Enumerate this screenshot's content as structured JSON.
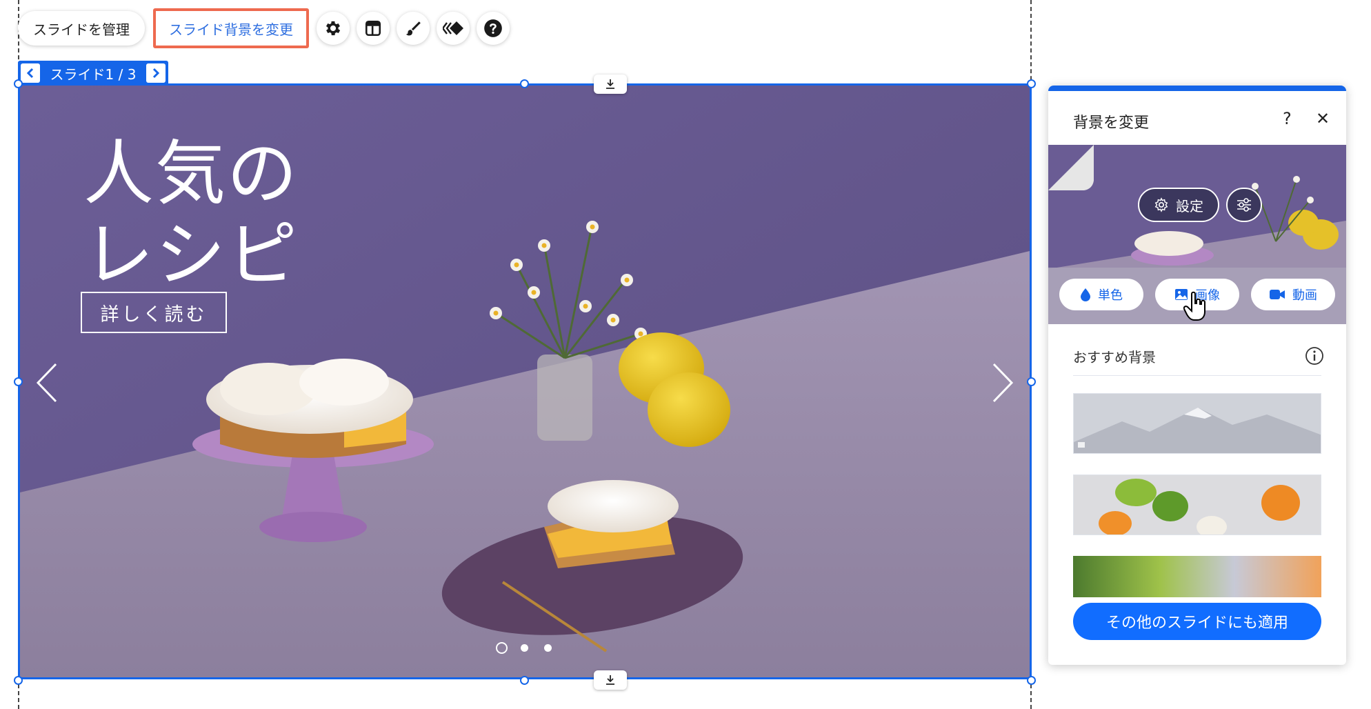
{
  "toolbar": {
    "manage_slides_label": "スライドを管理",
    "change_slide_bg_label": "スライド背景を変更",
    "icons": [
      "gear-icon",
      "layout-icon",
      "brush-icon",
      "animation-icon",
      "help-icon"
    ]
  },
  "slide_nav": {
    "label": "スライド1 / 3"
  },
  "slide": {
    "title_line1": "人気の",
    "title_line2": "レシピ",
    "button_label": "詳しく読む",
    "dots_count": 3,
    "active_dot": 1
  },
  "panel": {
    "title": "背景を変更",
    "help_label": "?",
    "close_label": "✕",
    "settings_label": "設定",
    "type_buttons": [
      {
        "label": "単色",
        "icon": "drop-icon"
      },
      {
        "label": "画像",
        "icon": "image-icon"
      },
      {
        "label": "動画",
        "icon": "video-icon"
      }
    ],
    "section_label": "おすすめ背景",
    "info_icon": "info-icon",
    "apply_button_label": "その他のスライドにも適用"
  },
  "colors": {
    "accent_blue": "#1565e8",
    "highlight": "#ee6a4f",
    "apply_blue": "#116dff",
    "slide_wall": "#6a5c94",
    "slide_table": "#9a8fa9"
  }
}
